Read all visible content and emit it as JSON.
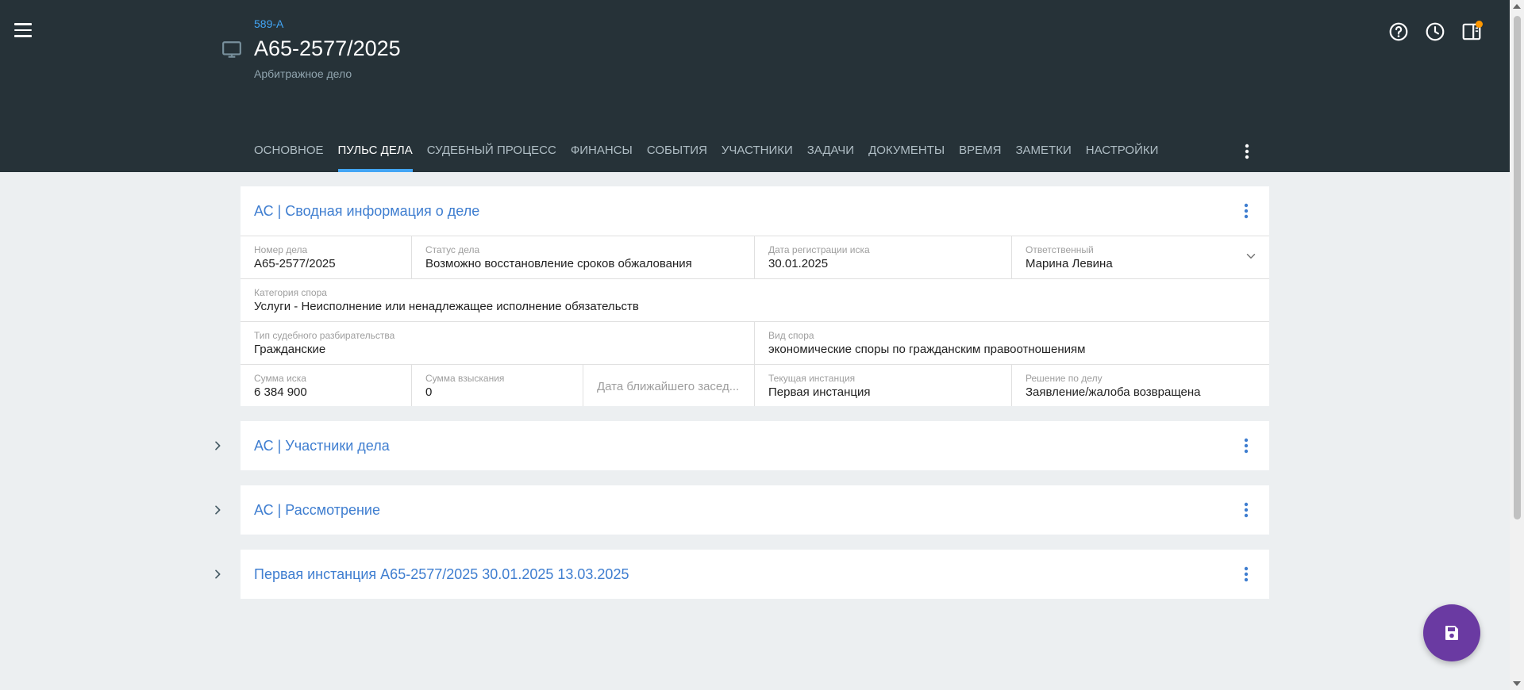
{
  "header": {
    "case_code": "589-А",
    "case_title": "А65-2577/2025",
    "case_subtitle": "Арбитражное дело"
  },
  "tabs": [
    {
      "label": "ОСНОВНОЕ"
    },
    {
      "label": "ПУЛЬС ДЕЛА",
      "active": true
    },
    {
      "label": "СУДЕБНЫЙ ПРОЦЕСС"
    },
    {
      "label": "ФИНАНСЫ"
    },
    {
      "label": "СОБЫТИЯ"
    },
    {
      "label": "УЧАСТНИКИ"
    },
    {
      "label": "ЗАДАЧИ"
    },
    {
      "label": "ДОКУМЕНТЫ"
    },
    {
      "label": "ВРЕМЯ"
    },
    {
      "label": "ЗАМЕТКИ"
    },
    {
      "label": "НАСТРОЙКИ"
    }
  ],
  "summary": {
    "title": "АС | Сводная информация о деле",
    "case_number": {
      "label": "Номер дела",
      "value": "А65-2577/2025"
    },
    "case_status": {
      "label": "Статус дела",
      "value": "Возможно восстановление сроков обжалования"
    },
    "claim_date": {
      "label": "Дата регистрации иска",
      "value": "30.01.2025"
    },
    "responsible": {
      "label": "Ответственный",
      "value": "Марина Левина"
    },
    "dispute_category": {
      "label": "Категория спора",
      "value": "Услуги - Неисполнение или ненадлежащее исполнение обязательств"
    },
    "proceeding_type": {
      "label": "Тип судебного разбирательства",
      "value": "Гражданские"
    },
    "dispute_kind": {
      "label": "Вид спора",
      "value": "экономические споры по гражданским правоотношениям"
    },
    "claim_amount": {
      "label": "Сумма иска",
      "value": "6 384 900"
    },
    "recovery_amount": {
      "label": "Сумма взыскания",
      "value": "0"
    },
    "next_hearing": {
      "placeholder": "Дата ближайшего засед..."
    },
    "current_instance": {
      "label": "Текущая инстанция",
      "value": "Первая инстанция"
    },
    "decision": {
      "label": "Решение по делу",
      "value": "Заявление/жалоба возвращена"
    }
  },
  "sections": [
    {
      "title": "АС | Участники дела"
    },
    {
      "title": "АС | Рассмотрение"
    },
    {
      "title": "Первая инстанция А65-2577/2025 30.01.2025 13.03.2025"
    }
  ],
  "icons": {
    "menu": "menu-icon",
    "case": "monitor-icon",
    "help": "help-circle-icon",
    "history": "clock-icon",
    "panel": "panel-icon",
    "more": "more-vertical-icon",
    "expand": "chevron-right-icon",
    "dropdown": "chevron-down-icon",
    "save": "save-icon"
  },
  "colors": {
    "header_bg": "#263238",
    "accent_blue": "#42a5f5",
    "link_blue": "#3f7ed0",
    "fab": "#6a3aa2",
    "notification": "#ff9800",
    "page_bg": "#eceff1"
  }
}
